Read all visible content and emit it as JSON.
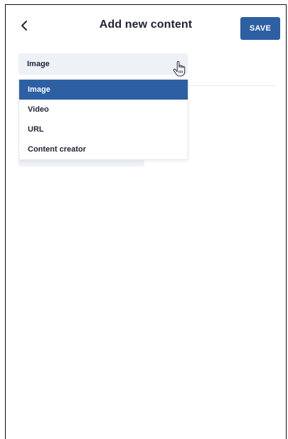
{
  "header": {
    "title": "Add new content",
    "back_icon": "chevron-left-icon",
    "save_label": "SAVE"
  },
  "colors": {
    "accent": "#2d5fa3",
    "field_bg": "#eef1f6",
    "text": "#1f2433"
  },
  "content_type_select": {
    "value": "Image",
    "open": true,
    "options": [
      {
        "label": "Image",
        "selected": true
      },
      {
        "label": "Video",
        "selected": false
      },
      {
        "label": "URL",
        "selected": false
      },
      {
        "label": "Content creator",
        "selected": false
      }
    ]
  },
  "pointer": "hand-pointer-icon"
}
